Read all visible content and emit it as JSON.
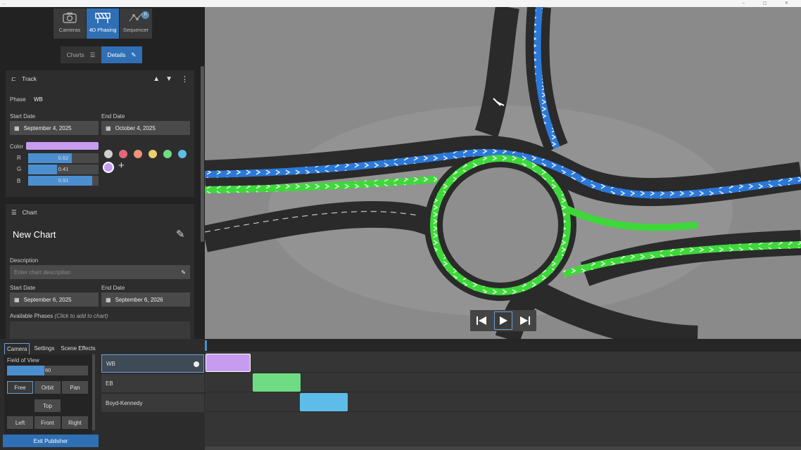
{
  "titlebar": {
    "text": "..."
  },
  "modes": [
    {
      "label": "Cameras",
      "icon": "camera-icon"
    },
    {
      "label": "4D Phasing",
      "icon": "roadblock-icon"
    },
    {
      "label": "Sequencer",
      "icon": "sequencer-icon",
      "badge": "II"
    }
  ],
  "subtabs": {
    "charts": "Charts",
    "details": "Details"
  },
  "track": {
    "title": "Track",
    "phase_label": "Phase",
    "phase_value": "WB",
    "start_label": "Start Date",
    "start_value": "September 4, 2025",
    "end_label": "End Date",
    "end_value": "October 4, 2025",
    "color_label": "Color",
    "color_value": "#c79bf0",
    "r_label": "R",
    "r_value": "0.62",
    "g_label": "G",
    "g_value": "0.41",
    "b_label": "B",
    "b_value": "0.91",
    "palette": [
      "#cfcfcf",
      "#e5677a",
      "#f0937a",
      "#eccf6a",
      "#6fdc83",
      "#5dbde8",
      "#c79bf0"
    ]
  },
  "chart": {
    "title": "Chart",
    "name": "New Chart",
    "desc_label": "Description",
    "desc_placeholder": "Enter chart description",
    "start_label": "Start Date",
    "start_value": "September 6, 2025",
    "end_label": "End Date",
    "end_value": "September 6, 2026",
    "phases_label": "Available Phases",
    "phases_hint": "(Click to add to chart)"
  },
  "bottom_tabs": {
    "camera": "Camera",
    "settings": "Settings",
    "effects": "Scene Effects"
  },
  "camera_panel": {
    "fov_label": "Field of View",
    "fov_value": "60",
    "free": "Free",
    "orbit": "Orbit",
    "pan": "Pan",
    "top": "Top",
    "left": "Left",
    "front": "Front",
    "right": "Right",
    "exit": "Exit Publisher"
  },
  "tracks": [
    {
      "name": "WB",
      "color": "#c79bf0"
    },
    {
      "name": "EB",
      "color": "#6fdc83"
    },
    {
      "name": "Boyd-Kennedy",
      "color": "#5dbde8"
    }
  ]
}
